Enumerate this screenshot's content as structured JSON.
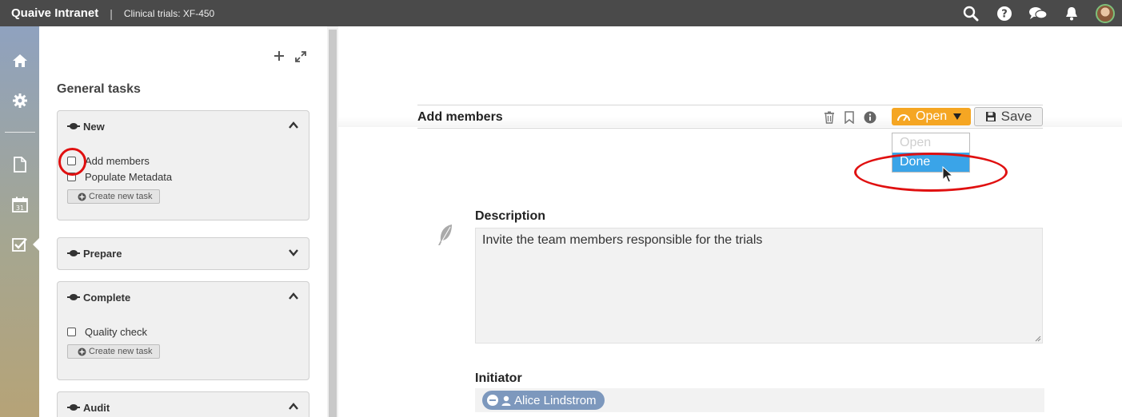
{
  "topbar": {
    "brand": "Quaive Intranet",
    "separator": "|",
    "breadcrumb": "Clinical trials: XF-450",
    "icons": [
      "search-icon",
      "help-icon",
      "chat-icon",
      "bell-icon",
      "avatar"
    ]
  },
  "rail": {
    "icons": [
      "home-icon",
      "gear-icon",
      "document-icon",
      "calendar-icon",
      "tasks-icon"
    ],
    "calendar_day": "31",
    "active": "tasks-icon"
  },
  "sidebar": {
    "title": "General tasks",
    "groups": [
      {
        "label": "New",
        "expanded": true,
        "tasks": [
          "Add members",
          "Populate Metadata"
        ],
        "create_label": "Create new task"
      },
      {
        "label": "Prepare",
        "expanded": false,
        "tasks": []
      },
      {
        "label": "Complete",
        "expanded": true,
        "tasks": [
          "Quality check"
        ],
        "create_label": "Create new task"
      },
      {
        "label": "Audit",
        "expanded": true,
        "tasks": []
      }
    ]
  },
  "main": {
    "task_title": "Add members",
    "state_label": "Open",
    "save_label": "Save",
    "dropdown_options": [
      "Open",
      "Done"
    ],
    "dropdown_highlighted": "Done",
    "description_label": "Description",
    "description_text": "Invite the team members responsible for the trials",
    "initiator_label": "Initiator",
    "initiator_name": "Alice Lindstrom"
  },
  "colors": {
    "topbar": "#4a4a4a",
    "state_orange": "#f5a623",
    "dropdown_highlight": "#3aa4e8",
    "pill_blue": "#7d98bd",
    "annotation_red": "#e01010"
  }
}
